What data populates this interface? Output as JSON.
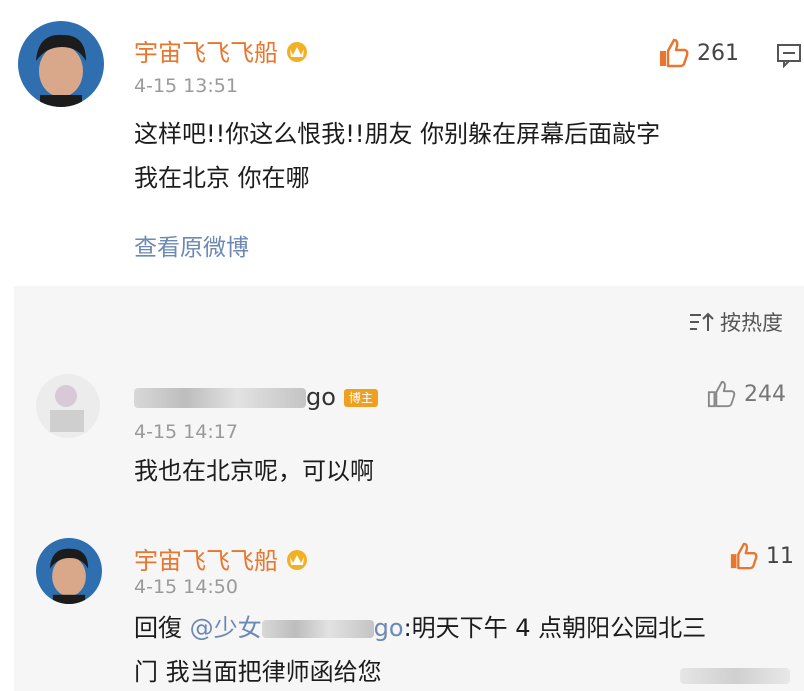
{
  "post": {
    "username": "宇宙飞飞飞船",
    "time": "4-15 13:51",
    "likes": "261",
    "text_line1": "这样吧!!你这么恨我!!朋友 你别躲在屏幕后面敲字",
    "text_line2": "我在北京 你在哪",
    "view_original": "查看原微博"
  },
  "sort_label": "按热度",
  "comments": [
    {
      "username_tail": "go",
      "badge": "博主",
      "time": "4-15 14:17",
      "likes": "244",
      "text": "我也在北京呢，可以啊"
    },
    {
      "username": "宇宙飞飞飞船",
      "time": "4-15 14:50",
      "likes": "11",
      "reply_prefix": "回復",
      "mention_start": "@少女",
      "mention_end": "go",
      "reply_rest": ":明天下午 4 点朝阳公园北三",
      "reply_line2": "门 我当面把律师函给您"
    }
  ],
  "colors": {
    "username": "#e8762c",
    "link": "#6b89b4",
    "time": "#9a9a9a",
    "comments_bg": "#f6f6f6"
  }
}
